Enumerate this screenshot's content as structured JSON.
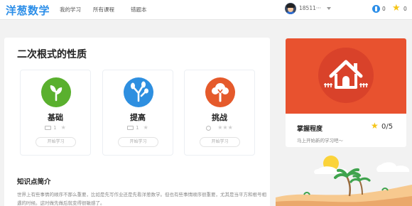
{
  "header": {
    "logo": "洋葱数学",
    "nav": [
      "我的学习",
      "所有课程",
      "错题本"
    ],
    "user_phone": "18511···",
    "coins": "0",
    "stars": "0"
  },
  "main": {
    "title": "二次根式的性质",
    "levels": [
      {
        "name": "基础",
        "video_count": "1",
        "stars": "★",
        "button": "开始学习",
        "color": "#5ab02e"
      },
      {
        "name": "提高",
        "video_count": "1",
        "stars": "★",
        "button": "开始学习",
        "color": "#2e8fe0"
      },
      {
        "name": "挑战",
        "video_count": "",
        "stars": "★★★",
        "button": "开始学习",
        "color": "#e55a2b"
      }
    ],
    "intro_title": "知识点简介",
    "intro_text": "世界上有些事情的顺序不那么重要，比如是先写作业还是先看洋葱数学。但也有些事情顺序很重要，尤其是当平方和根号相遇的时候。这时做先做后就变得很敏感了。"
  },
  "mastery": {
    "label": "掌握程度",
    "score": "0/5",
    "hint": "马上开始新的学习吧～",
    "color": "#e8522f"
  }
}
